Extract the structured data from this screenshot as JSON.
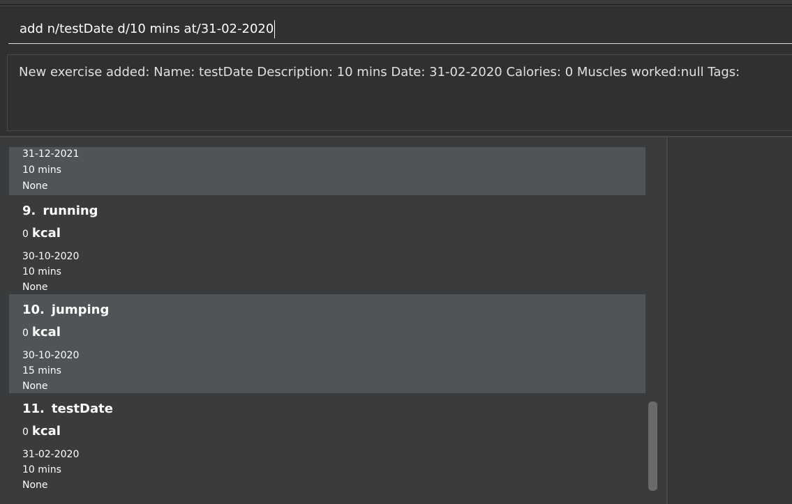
{
  "command_box": {
    "value": "add n/testDate d/10 mins at/31-02-2020"
  },
  "result_display": {
    "text": "New exercise added: Name: testDate Description: 10 mins Date: 31-02-2020 Calories: 0 Muscles worked:null Tags:"
  },
  "exercise_list": {
    "partial_card": {
      "date": "31-12-2021",
      "description": "10 mins",
      "tags": "None"
    },
    "cards": [
      {
        "index": "9.",
        "name": "running",
        "calories": "0",
        "unit": "kcal",
        "date": "30-10-2020",
        "description": "10 mins",
        "tags": "None"
      },
      {
        "index": "10.",
        "name": "jumping",
        "calories": "0",
        "unit": "kcal",
        "date": "30-10-2020",
        "description": "15 mins",
        "tags": "None"
      },
      {
        "index": "11.",
        "name": "testDate",
        "calories": "0",
        "unit": "kcal",
        "date": "31-02-2020",
        "description": "10 mins",
        "tags": "None"
      }
    ]
  },
  "colors": {
    "background": "#2f3031",
    "card_alt": "#4f5557",
    "card_normal": "#3a3b3c",
    "text": "#ffffff"
  }
}
